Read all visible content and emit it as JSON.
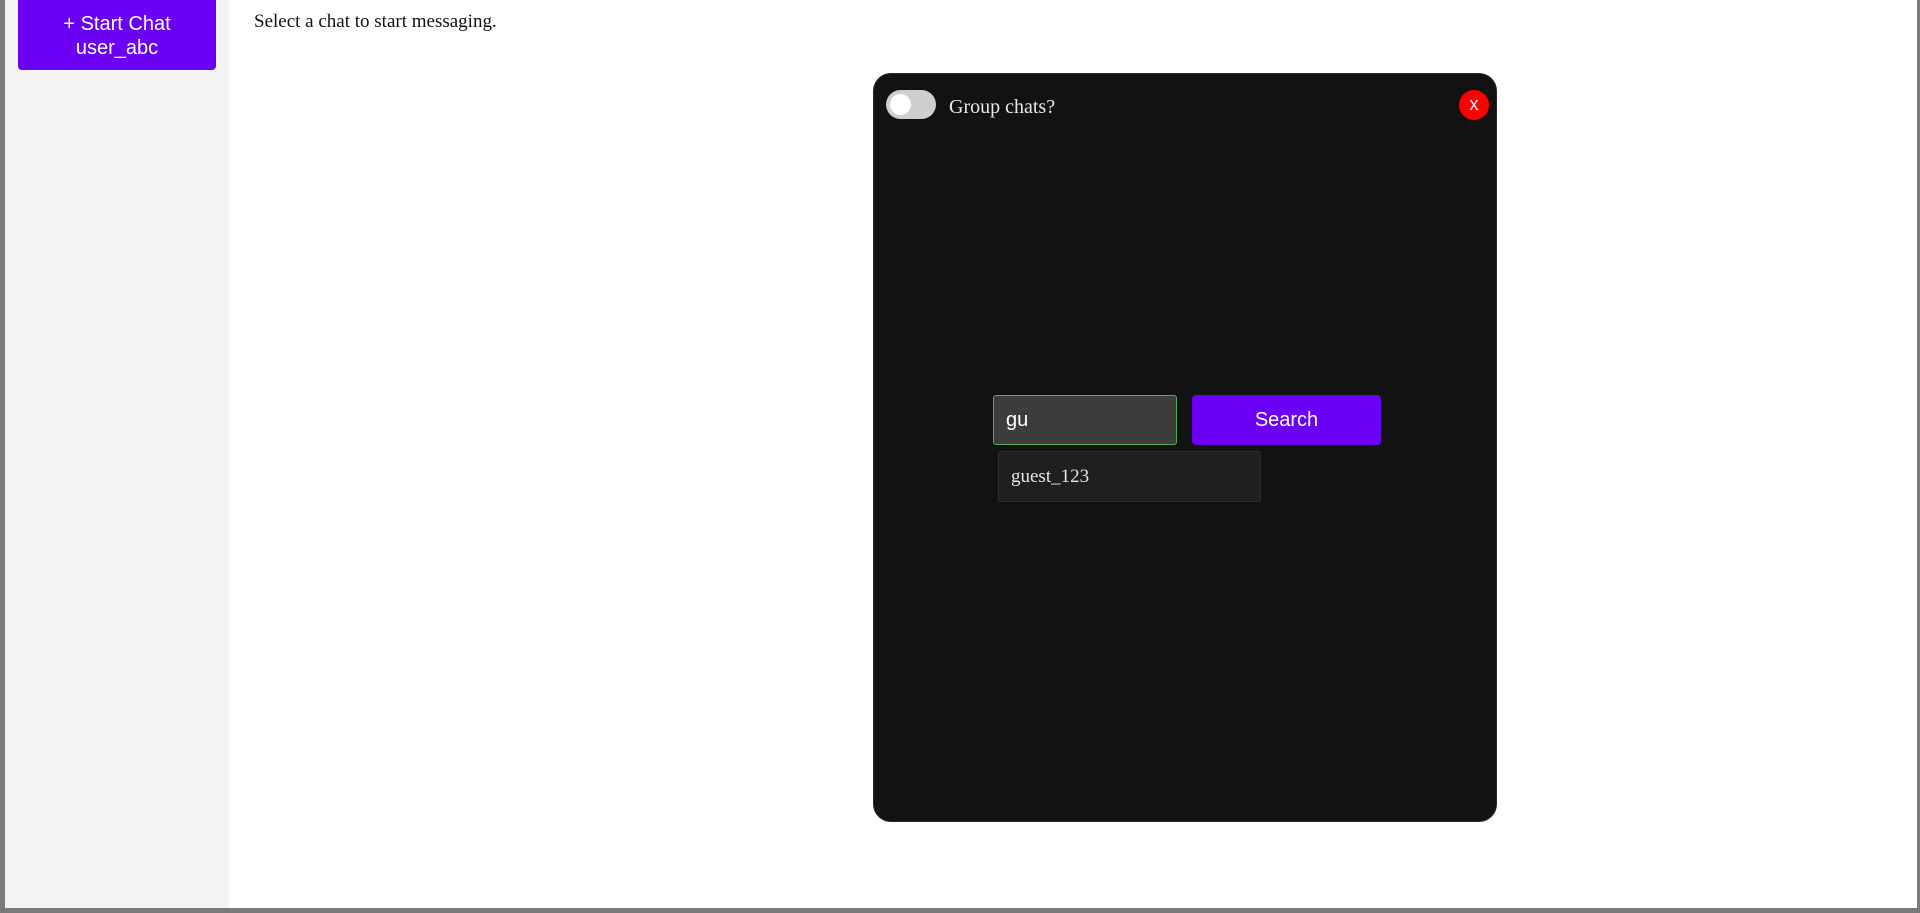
{
  "sidebar": {
    "start_chat_label": "+ Start Chat",
    "username": "user_abc"
  },
  "main": {
    "placeholder": "Select a chat to start messaging."
  },
  "modal": {
    "group_toggle_label": "Group chats?",
    "group_toggle_on": false,
    "close_label": "x",
    "search": {
      "value": "gu",
      "button_label": "Search"
    },
    "suggestions": [
      {
        "label": "guest_123"
      }
    ]
  },
  "colors": {
    "accent": "#6a00f4",
    "modal_bg": "#121212",
    "close": "#ff0000",
    "input_border": "#4caf50"
  }
}
